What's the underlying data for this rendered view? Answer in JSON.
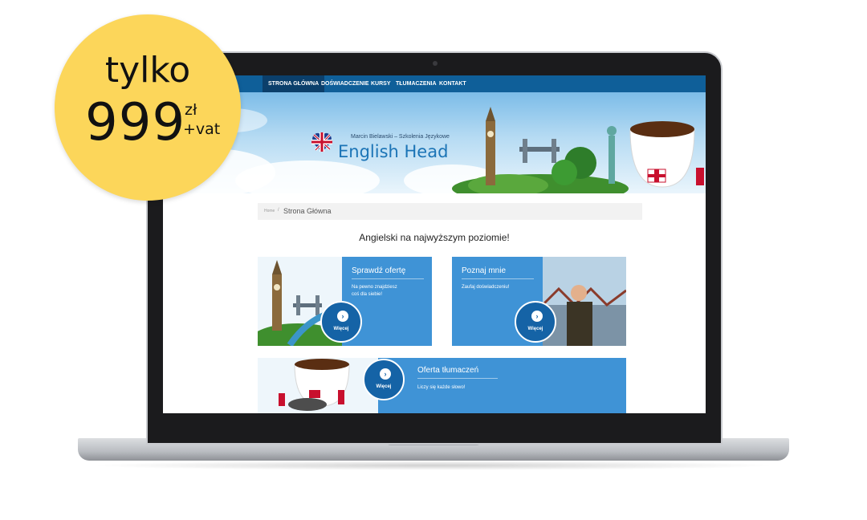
{
  "badge": {
    "word": "tylko",
    "price": "999",
    "currency": "zł",
    "vat": "+vat"
  },
  "site": {
    "nav": [
      "Strona Główna",
      "Doświadczenie",
      "Kursy",
      "Tłumaczenia",
      "Kontakt"
    ],
    "hero": {
      "subtitle": "Marcin Bielawski – Szkolenia Językowe",
      "title": "English Head"
    },
    "breadcrumb": {
      "home": "Home",
      "separator": "/",
      "current": "Strona Główna"
    },
    "headline": "Angielski na najwyższym poziomie!",
    "cards": [
      {
        "title": "Sprawdź ofertę",
        "text_line1": "Na pewno znajdziesz",
        "text_line2": "coś dla siebie!",
        "button": "Więcej"
      },
      {
        "title": "Poznaj mnie",
        "text_line1": "Zaufaj doświadczeniu!",
        "button": "Więcej"
      },
      {
        "title": "Oferta tłumaczeń",
        "text_line1": "Liczy się każde słowo!",
        "button": "Więcej"
      }
    ]
  },
  "colors": {
    "badge": "#fcd65a",
    "nav": "#0f5f99",
    "card": "#3f93d6",
    "button": "#1563a6",
    "title": "#1b74b6"
  },
  "icons": {
    "camera": "camera-dot",
    "flag": "uk-flag-heart-icon",
    "arrow": "arrow-right-circle-icon"
  }
}
